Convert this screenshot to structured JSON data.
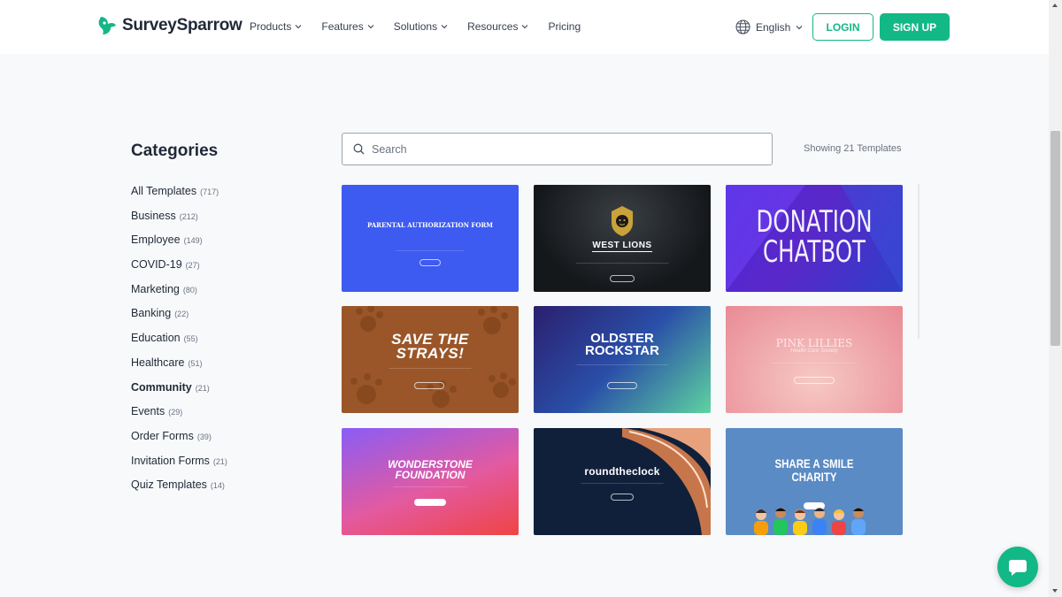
{
  "header": {
    "logo_text": "SurveySparrow",
    "nav": [
      {
        "label": "Products",
        "dropdown": true
      },
      {
        "label": "Features",
        "dropdown": true
      },
      {
        "label": "Solutions",
        "dropdown": true
      },
      {
        "label": "Resources",
        "dropdown": true
      },
      {
        "label": "Pricing",
        "dropdown": false
      }
    ],
    "language": "English",
    "login_label": "LOGIN",
    "signup_label": "SIGN UP"
  },
  "sidebar": {
    "title": "Categories",
    "items": [
      {
        "label": "All Templates",
        "count": "(717)",
        "active": false
      },
      {
        "label": "Business",
        "count": "(212)",
        "active": false
      },
      {
        "label": "Employee",
        "count": "(149)",
        "active": false
      },
      {
        "label": "COVID-19",
        "count": "(27)",
        "active": false
      },
      {
        "label": "Marketing",
        "count": "(80)",
        "active": false
      },
      {
        "label": "Banking",
        "count": "(22)",
        "active": false
      },
      {
        "label": "Education",
        "count": "(55)",
        "active": false
      },
      {
        "label": "Healthcare",
        "count": "(51)",
        "active": false
      },
      {
        "label": "Community",
        "count": "(21)",
        "active": true
      },
      {
        "label": "Events",
        "count": "(29)",
        "active": false
      },
      {
        "label": "Order Forms",
        "count": "(39)",
        "active": false
      },
      {
        "label": "Invitation Forms",
        "count": "(21)",
        "active": false
      },
      {
        "label": "Quiz Templates",
        "count": "(14)",
        "active": false
      }
    ]
  },
  "search": {
    "placeholder": "Search",
    "showing_text": "Showing 21 Templates"
  },
  "templates": [
    {
      "title": "PARENTAL AUTHORIZATION FORM"
    },
    {
      "title": "WEST LIONS"
    },
    {
      "title": "DONATION CHATBOT"
    },
    {
      "title": "SAVE THE STRAYS!"
    },
    {
      "title": "OLDSTER ROCKSTAR"
    },
    {
      "title": "PINK LILLIES",
      "subtitle": "Health Care Society"
    },
    {
      "title": "WONDERSTONE FOUNDATION"
    },
    {
      "title": "roundtheclock"
    },
    {
      "title": "SHARE A SMILE CHARITY"
    }
  ],
  "colors": {
    "accent": "#12b886",
    "text": "#1f2937",
    "muted": "#6b7280",
    "page_bg": "#f8f9fb"
  },
  "icons": {
    "logo": "sparrow-logo-icon",
    "globe": "globe-icon",
    "search": "search-icon",
    "chat": "chat-bubble-icon",
    "dropdown": "chevron-down-icon"
  }
}
